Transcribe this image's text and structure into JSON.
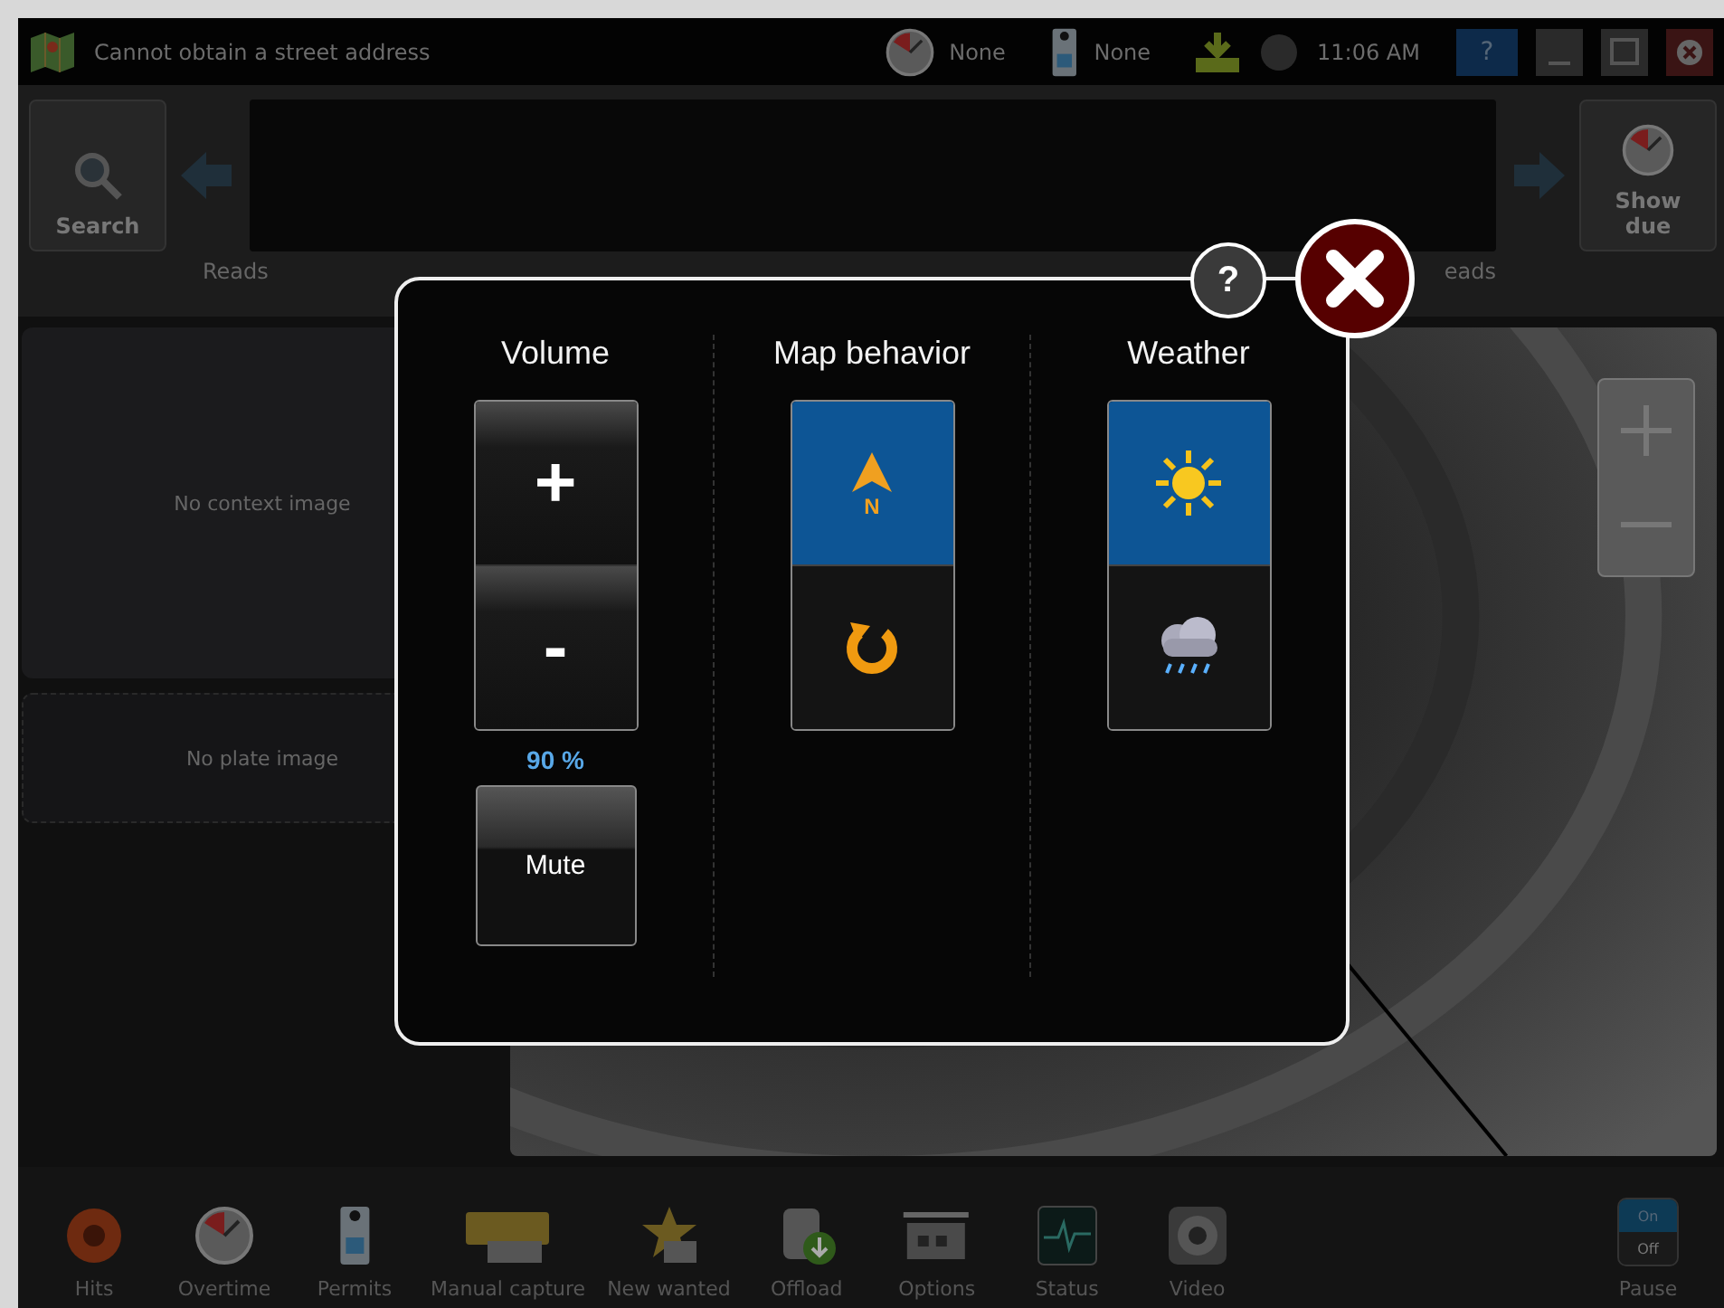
{
  "title_bar": {
    "status": "Cannot obtain a street address",
    "indicators": [
      {
        "kind": "clock",
        "text": "None"
      },
      {
        "kind": "permit",
        "text": "None"
      }
    ],
    "time": "11:06 AM",
    "help": "?"
  },
  "toolbar": {
    "search": "Search",
    "show_due": "Show due",
    "reads_left": "Reads",
    "reads_right": "eads"
  },
  "left_panel": {
    "context_image": "No context image",
    "plate_image": "No plate image"
  },
  "dialog": {
    "help": "?",
    "volume": {
      "title": "Volume",
      "plus": "+",
      "minus": "-",
      "reading": "90 %",
      "mute": "Mute"
    },
    "map_behavior": {
      "title": "Map behavior",
      "options": [
        {
          "kind": "north",
          "letter": "N",
          "selected": true
        },
        {
          "kind": "rotate",
          "selected": false
        }
      ]
    },
    "weather": {
      "title": "Weather",
      "options": [
        {
          "kind": "sun",
          "selected": true
        },
        {
          "kind": "rain",
          "selected": false
        }
      ]
    }
  },
  "bottom_bar": [
    {
      "kind": "bell",
      "label": "Hits"
    },
    {
      "kind": "clock",
      "label": "Overtime"
    },
    {
      "kind": "permit",
      "label": "Permits"
    },
    {
      "kind": "plate",
      "label": "Manual capture"
    },
    {
      "kind": "badge",
      "label": "New wanted"
    },
    {
      "kind": "offload",
      "label": "Offload"
    },
    {
      "kind": "options",
      "label": "Options"
    },
    {
      "kind": "status",
      "label": "Status"
    },
    {
      "kind": "video",
      "label": "Video"
    }
  ],
  "pause": {
    "label": "Pause",
    "on": "On",
    "off": "Off"
  }
}
